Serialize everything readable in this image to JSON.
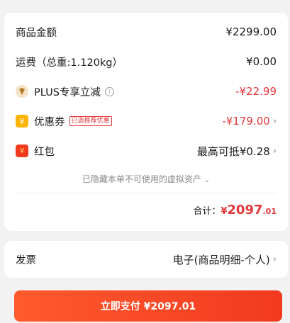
{
  "summary": {
    "goods_label": "商品金额",
    "goods_value": "¥2299.00",
    "shipping_label": "运费（总重:1.120kg）",
    "shipping_value": "¥0.00",
    "plus_label": "PLUS专享立减",
    "plus_value": "-¥22.99",
    "coupon_label": "优惠券",
    "coupon_tag": "已选推荐优惠",
    "coupon_value": "-¥179.00",
    "redpacket_label": "红包",
    "redpacket_value": "最高可抵¥0.28",
    "hidden_note": "已隐藏本单不可使用的虚拟资产",
    "total_label": "合计：",
    "total_currency": "¥",
    "total_int": "2097",
    "total_dec": ".01"
  },
  "invoice": {
    "label": "发票",
    "value": "电子(商品明细-个人)"
  },
  "pay_button": {
    "label": "立即支付 ¥2097.01"
  },
  "colors": {
    "accent": "#e4393c",
    "button_start": "#ff5a2d",
    "button_end": "#f23a1f"
  },
  "icons": {
    "plus": "plus-badge-icon",
    "coupon": "coupon-icon",
    "redpacket": "red-packet-icon",
    "info": "info-icon",
    "chevron": "chevron-right-icon"
  }
}
